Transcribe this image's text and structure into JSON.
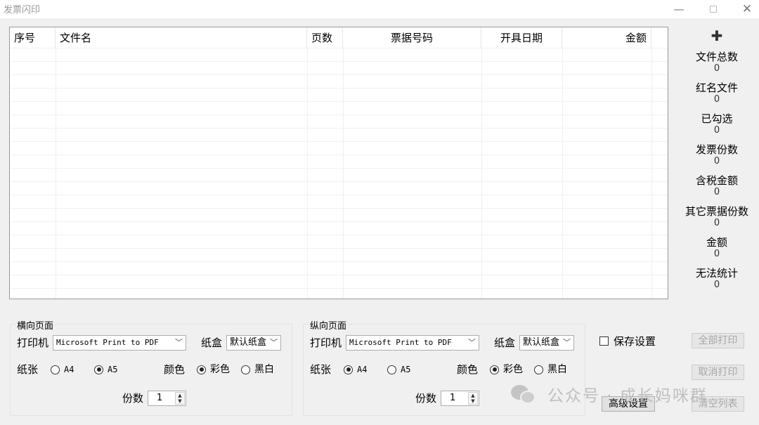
{
  "window": {
    "title": "发票闪印",
    "minimize": "—",
    "close": "✕"
  },
  "table": {
    "columns": [
      "序号",
      "文件名",
      "页数",
      "票据号码",
      "开具日期",
      "金额"
    ]
  },
  "sidebar": {
    "add_icon": "✚",
    "stats": [
      {
        "label": "文件总数",
        "value": "0"
      },
      {
        "label": "红名文件",
        "value": "0"
      },
      {
        "label": "已勾选",
        "value": "0"
      },
      {
        "label": "发票份数",
        "value": "0"
      },
      {
        "label": "含税金额",
        "value": "0"
      },
      {
        "label": "其它票据份数",
        "value": "0"
      },
      {
        "label": "金额",
        "value": "0"
      },
      {
        "label": "无法统计",
        "value": "0"
      }
    ]
  },
  "landscape": {
    "title": "横向页面",
    "printer_label": "打印机",
    "printer_value": "Microsoft Print to PDF",
    "tray_label": "纸盒",
    "tray_value": "默认纸盒",
    "paper_label": "纸张",
    "paper_a4": "A4",
    "paper_a5": "A5",
    "color_label": "颜色",
    "color_color": "彩色",
    "color_bw": "黑白",
    "copies_label": "份数",
    "copies_value": "1"
  },
  "portrait": {
    "title": "纵向页面",
    "printer_label": "打印机",
    "printer_value": "Microsoft Print to PDF",
    "tray_label": "纸盒",
    "tray_value": "默认纸盒",
    "paper_label": "纸张",
    "paper_a4": "A4",
    "paper_a5": "A5",
    "color_label": "颜色",
    "color_color": "彩色",
    "color_bw": "黑白",
    "copies_label": "份数",
    "copies_value": "1"
  },
  "actions": {
    "save_settings": "保存设置",
    "print_all": "全部打印",
    "cancel_print": "取消打印",
    "clear_list": "清空列表",
    "advanced": "高级设置"
  },
  "watermark": {
    "text": "公众号 · 成长妈咪群"
  }
}
